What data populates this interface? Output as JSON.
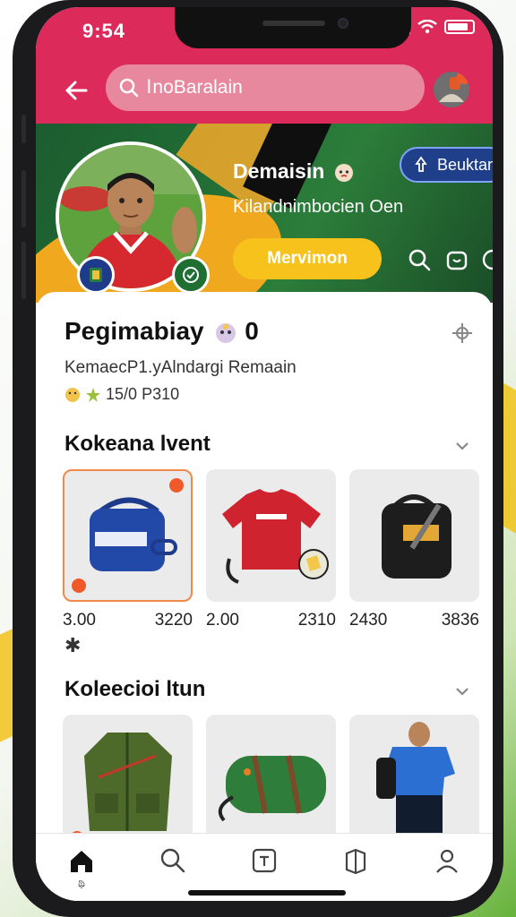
{
  "status": {
    "time": "9:54"
  },
  "header": {
    "search_text": "l noBaralain"
  },
  "profile": {
    "name": "Demaisin",
    "subtitle": "Kilandnimbocien  Oen",
    "follow_label": "Beuktam",
    "message_label": "Mervimon"
  },
  "card": {
    "title": "Pegimabiay",
    "title_count": "0",
    "subtitle": "KemaecP1.yAlndargi Remaain",
    "stats": "15/0 P310"
  },
  "sections": [
    {
      "title": "Kokeana lvent",
      "items": [
        {
          "name": "blue-bag",
          "price_left": "3.00",
          "price_right": "3220"
        },
        {
          "name": "red-jersey",
          "price_left": "2.00",
          "price_right": "2310"
        },
        {
          "name": "black-backpack",
          "price_left": "2430",
          "price_right": "3836"
        }
      ],
      "footnote": "✱"
    },
    {
      "title": "Koleecioi ltun",
      "items": [
        {
          "name": "green-jacket"
        },
        {
          "name": "green-duffel"
        },
        {
          "name": "blue-kit"
        }
      ]
    }
  ],
  "nav": {
    "items": [
      {
        "name": "home",
        "label": "ಥಿ"
      },
      {
        "name": "search",
        "label": ""
      },
      {
        "name": "create",
        "label": ""
      },
      {
        "name": "shop",
        "label": ""
      },
      {
        "name": "profile",
        "label": ""
      }
    ]
  },
  "colors": {
    "header": "#dc2a5a",
    "accent_yellow": "#f8c21d",
    "follow_blue": "#1f3f8a",
    "banner_green": "#1f6a34"
  }
}
